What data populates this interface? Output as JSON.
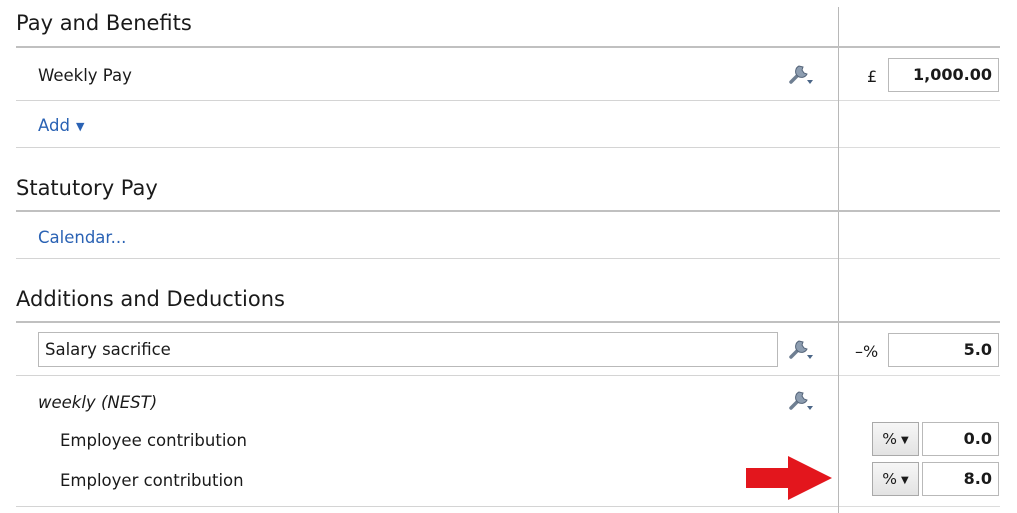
{
  "sections": {
    "pay_benefits": {
      "title": "Pay and Benefits",
      "weekly_pay": {
        "label": "Weekly Pay",
        "currency": "£",
        "value": "1,000.00"
      },
      "add_label": "Add"
    },
    "statutory_pay": {
      "title": "Statutory Pay",
      "calendar_link": "Calendar..."
    },
    "additions_deductions": {
      "title": "Additions and Deductions",
      "salary_sacrifice": {
        "value": "Salary sacrifice",
        "unit": "–%",
        "amount": "5.0"
      },
      "pension": {
        "label": "weekly (NEST)",
        "employee": {
          "label": "Employee contribution",
          "unit": "%",
          "amount": "0.0"
        },
        "employer": {
          "label": "Employer contribution",
          "unit": "%",
          "amount": "8.0"
        }
      }
    }
  },
  "icons": {
    "settings": "wrench-settings-icon",
    "annotation": "red-arrow-icon"
  },
  "colors": {
    "link": "#2a62b4",
    "arrow": "#e3161d"
  }
}
